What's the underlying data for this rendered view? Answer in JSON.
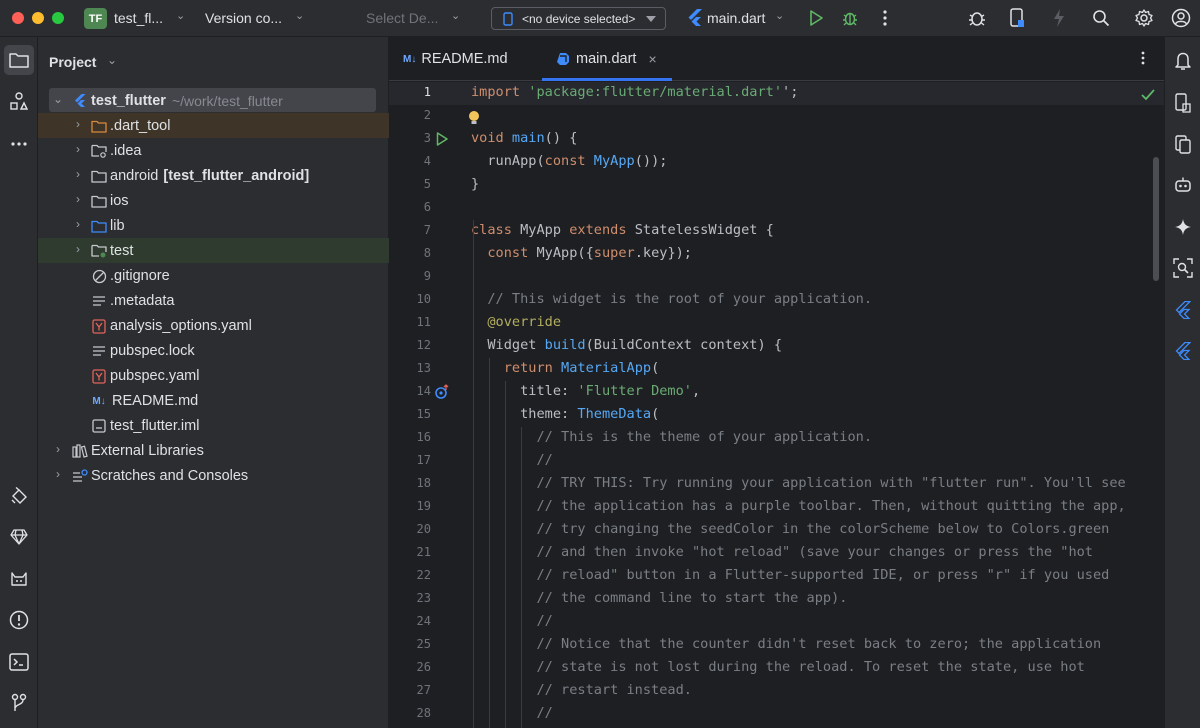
{
  "titlebar": {
    "project_badge": "TF",
    "project_name": "test_fl...",
    "vcs_label": "Version co...",
    "config_select": "Select De...",
    "device_select": "<no device selected>",
    "run_file": "main.dart"
  },
  "sidebar_left": {
    "icons": [
      "folder-icon",
      "structure-icon",
      "more-icon",
      "paint-icon",
      "gem-icon",
      "cat-icon",
      "problems-icon",
      "terminal-icon",
      "git-icon"
    ]
  },
  "project_panel": {
    "title": "Project",
    "root": {
      "name": "test_flutter",
      "path": "~/work/test_flutter"
    },
    "items": [
      {
        "label": ".dart_tool",
        "type": "folder-excluded",
        "expandable": true
      },
      {
        "label": ".idea",
        "type": "folder-config",
        "expandable": true
      },
      {
        "label": "android",
        "suffix": "[test_flutter_android]",
        "type": "folder",
        "expandable": true
      },
      {
        "label": "ios",
        "type": "folder",
        "expandable": true
      },
      {
        "label": "lib",
        "type": "folder-source",
        "expandable": true
      },
      {
        "label": "test",
        "type": "folder-test",
        "expandable": true
      },
      {
        "label": ".gitignore",
        "type": "ignore-file",
        "expandable": false
      },
      {
        "label": ".metadata",
        "type": "text-file",
        "expandable": false
      },
      {
        "label": "analysis_options.yaml",
        "type": "yaml-file",
        "expandable": false
      },
      {
        "label": "pubspec.lock",
        "type": "text-file",
        "expandable": false
      },
      {
        "label": "pubspec.yaml",
        "type": "yaml-file",
        "expandable": false
      },
      {
        "label": "README.md",
        "type": "markdown-file",
        "expandable": false
      },
      {
        "label": "test_flutter.iml",
        "type": "iml-file",
        "expandable": false
      }
    ],
    "external_libraries": "External Libraries",
    "scratches": "Scratches and Consoles"
  },
  "editor": {
    "tabs": [
      {
        "label": "README.md",
        "icon": "M↓",
        "active": false
      },
      {
        "label": "main.dart",
        "icon": "dart",
        "active": true
      }
    ],
    "line_numbers": [
      "1",
      "2",
      "3",
      "4",
      "5",
      "6",
      "7",
      "8",
      "9",
      "10",
      "11",
      "12",
      "13",
      "14",
      "15",
      "16",
      "17",
      "18",
      "19",
      "20",
      "21",
      "22",
      "23",
      "24",
      "25",
      "26",
      "27",
      "28"
    ],
    "lines": [
      [
        [
          "kw",
          "import "
        ],
        [
          "str",
          "'package:flutter/material.dart'"
        ],
        [
          "",
          "';"
        ]
      ],
      [],
      [
        [
          "kw",
          "void "
        ],
        [
          "fn",
          "main"
        ],
        [
          "",
          "() {"
        ]
      ],
      [
        [
          "",
          "  runApp("
        ],
        [
          "kw",
          "const "
        ],
        [
          "fn",
          "MyApp"
        ],
        [
          "",
          "());"
        ]
      ],
      [
        [
          "",
          "}"
        ]
      ],
      [],
      [
        [
          "kw",
          "class "
        ],
        [
          "",
          "MyApp "
        ],
        [
          "kw",
          "extends "
        ],
        [
          "",
          "StatelessWidget {"
        ]
      ],
      [
        [
          "",
          "  "
        ],
        [
          "kw",
          "const "
        ],
        [
          "",
          "MyApp({"
        ],
        [
          "kw",
          "super"
        ],
        [
          "",
          ".key});"
        ]
      ],
      [],
      [
        [
          "cmt",
          "  // This widget is the root of your application."
        ]
      ],
      [
        [
          "ann",
          "  @override"
        ]
      ],
      [
        [
          "",
          "  Widget "
        ],
        [
          "fn",
          "build"
        ],
        [
          "",
          "(BuildContext context) {"
        ]
      ],
      [
        [
          "",
          "    "
        ],
        [
          "kw",
          "return "
        ],
        [
          "fn",
          "MaterialApp"
        ],
        [
          "",
          "("
        ]
      ],
      [
        [
          "",
          "      title: "
        ],
        [
          "str",
          "'Flutter Demo'"
        ],
        [
          "",
          ","
        ]
      ],
      [
        [
          "",
          "      theme: "
        ],
        [
          "fn",
          "ThemeData"
        ],
        [
          "",
          "("
        ]
      ],
      [
        [
          "cmt",
          "        // This is the theme of your application."
        ]
      ],
      [
        [
          "cmt",
          "        //"
        ]
      ],
      [
        [
          "cmt",
          "        // TRY THIS: Try running your application with \"flutter run\". You'll see"
        ]
      ],
      [
        [
          "cmt",
          "        // the application has a purple toolbar. Then, without quitting the app,"
        ]
      ],
      [
        [
          "cmt",
          "        // try changing the seedColor in the colorScheme below to Colors.green"
        ]
      ],
      [
        [
          "cmt",
          "        // and then invoke \"hot reload\" (save your changes or press the \"hot"
        ]
      ],
      [
        [
          "cmt",
          "        // reload\" button in a Flutter-supported IDE, or press \"r\" if you used"
        ]
      ],
      [
        [
          "cmt",
          "        // the command line to start the app)."
        ]
      ],
      [
        [
          "cmt",
          "        //"
        ]
      ],
      [
        [
          "cmt",
          "        // Notice that the counter didn't reset back to zero; the application"
        ]
      ],
      [
        [
          "cmt",
          "        // state is not lost during the reload. To reset the state, use hot"
        ]
      ],
      [
        [
          "cmt",
          "        // restart instead."
        ]
      ],
      [
        [
          "cmt",
          "        //"
        ]
      ]
    ]
  },
  "colors": {
    "accent": "#3574f0",
    "keyword": "#cf8e6d",
    "string": "#6aab73",
    "function": "#56a8f5",
    "comment": "#7a7e85",
    "annotation": "#b3ae60"
  }
}
